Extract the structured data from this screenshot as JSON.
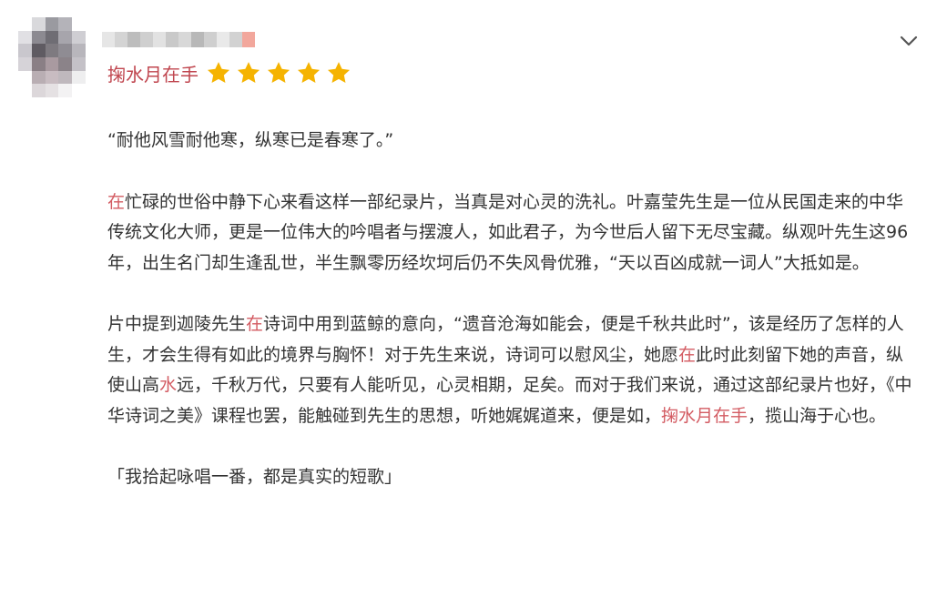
{
  "review": {
    "nickname": "掬水月在手",
    "rating": 5,
    "rating_max": 5,
    "accent_color": "#c0464f",
    "star_color": "#f5b301",
    "quote": "“耐他风雪耐他寒，纵寒已是春寒了。”",
    "p2": {
      "hl1": "在",
      "t1": "忙碌的世俗中静下心来看这样一部纪录片，当真是对心灵的洗礼。叶嘉莹先生是一位从民国走来的中华传统文化大师，更是一位伟大的吟唱者与摆渡人，如此君子，为今世后人留下无尽宝藏。纵观叶先生这96年，出生名门却生逢乱世，半生飘零历经坎坷后仍不失风骨优雅，“天以百凶成就一词人”大抵如是。"
    },
    "p3": {
      "t1": "片中提到迦陵先生",
      "hl1": "在",
      "t2": "诗词中用到蓝鲸的意向，“遗音沧海如能会，便是千秋共此时”，该是经历了怎样的人生，才会生得有如此的境界与胸怀！对于先生来说，诗词可以慰风尘，她愿",
      "hl2": "在",
      "t3": "此时此刻留下她的声音，纵使山高",
      "hl3": "水",
      "t4": "远，千秋万代，只要有人能听见，心灵相期，足矣。而对于我们来说，通过这部纪录片也好，《中华诗词之美》课程也罢，能触碰到先生的思想，听她娓娓道来，便是如，",
      "hl4": "掬水月在手",
      "t5": "，揽山海于心也。"
    },
    "closing": "「我拾起咏唱一番，都是真实的短歌」"
  },
  "icons": {
    "collapse": "chevron-down-icon",
    "star": "star-icon"
  }
}
